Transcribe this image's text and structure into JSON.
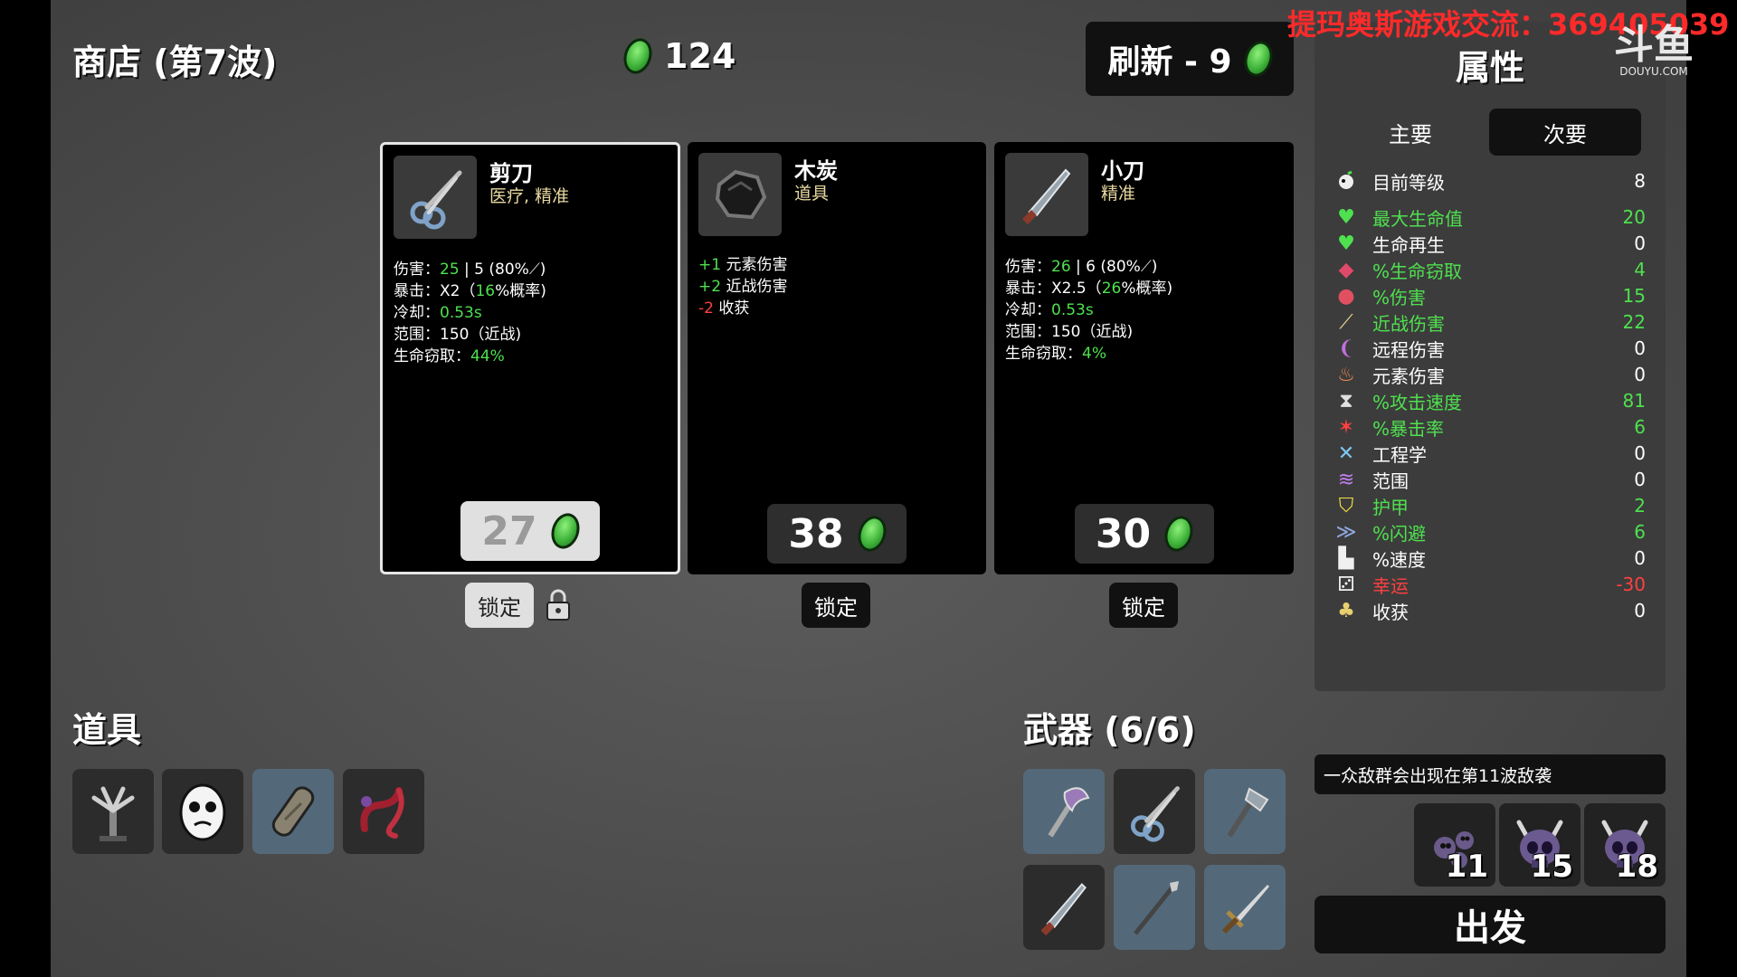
{
  "header": {
    "shop_title": "商店 (第7波)",
    "currency": "124",
    "reroll_label": "刷新 - 9"
  },
  "shop": [
    {
      "name": "剪刀",
      "tags": "医疗, 精准",
      "icon": "scissors-icon",
      "selected": true,
      "price": "27",
      "lock_label": "锁定",
      "stats": [
        {
          "label": "伤害：",
          "hi": "25",
          "rest": " | 5 (80%",
          "tail": ")"
        },
        {
          "label": "暴击：",
          "text": "X2（",
          "hi": "16",
          "after": "%概率)"
        },
        {
          "label": "冷却：",
          "hi": "0.53s"
        },
        {
          "label": "范围：",
          "text": "150（近战)"
        },
        {
          "label": "生命窃取：",
          "hi": "44%"
        }
      ]
    },
    {
      "name": "木炭",
      "tags": "道具",
      "icon": "coal-icon",
      "selected": false,
      "price": "38",
      "lock_label": "锁定",
      "effects": [
        {
          "value": "+1",
          "label": " 元素伤害",
          "color": "green"
        },
        {
          "value": "+2",
          "label": " 近战伤害",
          "color": "green"
        },
        {
          "value": "-2",
          "label": " 收获",
          "color": "red"
        }
      ]
    },
    {
      "name": "小刀",
      "tags": "精准",
      "icon": "knife-icon",
      "selected": false,
      "price": "30",
      "lock_label": "锁定",
      "stats": [
        {
          "label": "伤害：",
          "hi": "26",
          "rest": " | 6 (80%",
          "tail": ")"
        },
        {
          "label": "暴击：",
          "text": "X2.5（",
          "hi": "26",
          "after": "%概率)"
        },
        {
          "label": "冷却：",
          "hi": "0.53s"
        },
        {
          "label": "范围：",
          "text": "150（近战)"
        },
        {
          "label": "生命窃取：",
          "hi": "4%"
        }
      ]
    }
  ],
  "items_section": {
    "title": "道具",
    "items": [
      "claw-tree-icon",
      "ghost-mask-icon",
      "bandage-icon",
      "worm-icon"
    ]
  },
  "weapons_section": {
    "title": "武器 (6/6)",
    "weapons": [
      "double-axe-icon",
      "scissors-icon",
      "hatchet-icon",
      "knife-icon",
      "spear-icon",
      "sword-icon"
    ]
  },
  "stats_panel": {
    "title": "属性",
    "tab_primary": "主要",
    "tab_secondary": "次要",
    "level_label": "目前等级",
    "level_value": "8",
    "rows": [
      {
        "label": "最大生命值",
        "value": "20",
        "color": "green",
        "icon": "heart-icon"
      },
      {
        "label": "生命再生",
        "value": "0",
        "color": "white",
        "icon": "heart-plus-icon"
      },
      {
        "label": "%生命窃取",
        "value": "4",
        "color": "green",
        "icon": "fang-icon"
      },
      {
        "label": "%伤害",
        "value": "15",
        "color": "green",
        "icon": "fist-icon"
      },
      {
        "label": "近战伤害",
        "value": "22",
        "color": "green",
        "icon": "sword-icon"
      },
      {
        "label": "远程伤害",
        "value": "0",
        "color": "white",
        "icon": "bow-icon"
      },
      {
        "label": "元素伤害",
        "value": "0",
        "color": "white",
        "icon": "flame-icon"
      },
      {
        "label": "%攻击速度",
        "value": "81",
        "color": "green",
        "icon": "hourglass-icon"
      },
      {
        "label": "%暴击率",
        "value": "6",
        "color": "green",
        "icon": "crit-icon"
      },
      {
        "label": "工程学",
        "value": "0",
        "color": "white",
        "icon": "wrench-icon"
      },
      {
        "label": "范围",
        "value": "0",
        "color": "white",
        "icon": "range-icon"
      },
      {
        "label": "护甲",
        "value": "2",
        "color": "green",
        "icon": "shield-icon"
      },
      {
        "label": "%闪避",
        "value": "6",
        "color": "green",
        "icon": "dodge-icon"
      },
      {
        "label": "%速度",
        "value": "0",
        "color": "white",
        "icon": "boot-icon"
      },
      {
        "label": "幸运",
        "value": "-30",
        "color": "red",
        "icon": "dice-icon"
      },
      {
        "label": "收获",
        "value": "0",
        "color": "white",
        "icon": "harvest-icon"
      }
    ]
  },
  "wave_notice": "一众敌群会出现在第11波敌袭",
  "enemies": [
    {
      "icon": "slime-swarm-icon",
      "count": "11"
    },
    {
      "icon": "horned-skull-icon",
      "count": "15"
    },
    {
      "icon": "horned-skull-icon",
      "count": "18"
    }
  ],
  "go_label": "出发",
  "watermark": "提玛奥斯游戏交流：369405039",
  "logo": {
    "l1": "斗鱼",
    "l2": "DOUYU.COM"
  },
  "colors": {
    "green": "#4fe04f",
    "red": "#ff4040",
    "coin": "#3fb33a"
  }
}
